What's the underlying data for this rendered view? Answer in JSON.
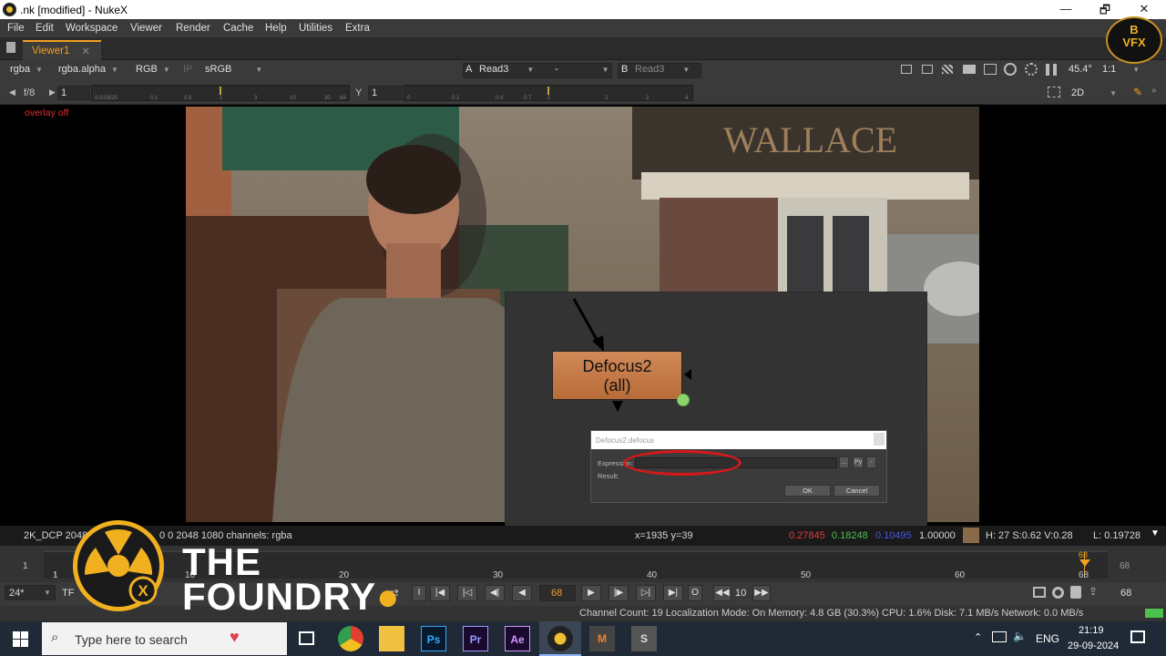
{
  "window": {
    "title": ".nk [modified] - NukeX",
    "minimize": "—",
    "maximize": "🗗",
    "close": "✕"
  },
  "menu": [
    "File",
    "Edit",
    "Workspace",
    "Viewer",
    "Render",
    "Cache",
    "Help",
    "Utilities",
    "Extra"
  ],
  "tab": {
    "label": "Viewer1",
    "close": "✕"
  },
  "viewer_toolbar": {
    "channels": "rgba",
    "alpha": "rgba.alpha",
    "display": "RGB",
    "ip": "IP",
    "lut": "sRGB",
    "a_label": "A",
    "a_input": "Read3",
    "op": "-",
    "b_label": "B",
    "b_input": "Read3",
    "zoom": "45.4°",
    "ratio": "1:1"
  },
  "gain_toolbar": {
    "fstop": "f/8",
    "gain_value": "1",
    "gain_ticks": [
      "0.015625",
      "0.1",
      "0.5",
      "1",
      "3",
      "10",
      "30",
      "64"
    ],
    "y_label": "Y",
    "gamma_value": "1",
    "gamma_ticks": [
      "0",
      "0.1",
      "0.4",
      "0.7",
      "1",
      "2",
      "3",
      "4"
    ],
    "view_mode": "2D"
  },
  "overlay_text": "overlay off",
  "node": {
    "line1": "Defocus2",
    "line2": "(all)"
  },
  "dialog": {
    "title": "Defocus2.defocus",
    "expression_label": "Expression:",
    "result_label": "Result:",
    "btn_dots": "...",
    "btn_py": "Py",
    "btn_misc": "-",
    "ok": "OK",
    "cancel": "Cancel"
  },
  "infobar": {
    "format": "2K_DCP 2048x1080",
    "bbox": "0 0 2048 1080 channels: rgba",
    "coords": "x=1935 y=39",
    "r": "0.27845",
    "g": "0.18248",
    "b": "0.10495",
    "a": "1.00000",
    "hsv": "H: 27 S:0.62 V:0.28",
    "lum": "L: 0.19728",
    "colors": {
      "r": "#e03c3c",
      "g": "#4ec04e",
      "b": "#4a5ae0"
    }
  },
  "timeline": {
    "start": "1",
    "end": "68",
    "current": "68",
    "labels": [
      "1",
      "10",
      "20",
      "30",
      "40",
      "50",
      "60",
      "68"
    ],
    "accent": "#f0a020"
  },
  "playback": {
    "fps": "24*",
    "tf": "TF",
    "frame": "68",
    "step": "10",
    "end_frame": "68"
  },
  "status": "Channel Count: 19  Localization Mode: On  Memory: 4.8 GB (30.3%)  CPU: 1.6%  Disk: 7.1 MB/s  Network: 0.0 MB/s",
  "overlay_logo": {
    "line1": "THE",
    "line2": "FOUNDRY",
    "watermark_line1": "B",
    "watermark_line2": "VFX"
  },
  "taskbar": {
    "search_placeholder": "Type here to search",
    "apps": [
      "Ps",
      "Pr",
      "Ae"
    ],
    "lang": "ENG",
    "time": "21:19",
    "date": "29-09-2024"
  }
}
